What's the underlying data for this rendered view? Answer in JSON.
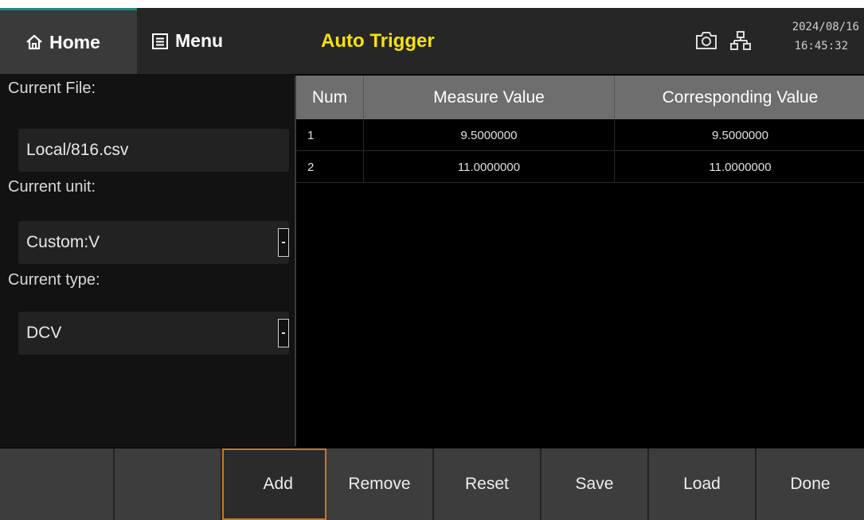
{
  "header": {
    "home_label": "Home",
    "menu_label": "Menu",
    "title": "Auto Trigger",
    "date": "2024/08/16",
    "time": "16:45:32"
  },
  "left": {
    "current_file_label": "Current File:",
    "current_file_value": "Local/816.csv",
    "current_unit_label": "Current unit:",
    "current_unit_value": "Custom:V",
    "current_type_label": "Current type:",
    "current_type_value": "DCV"
  },
  "table": {
    "columns": [
      "Num",
      "Measure Value",
      "Corresponding Value"
    ],
    "rows": [
      {
        "num": "1",
        "measure": "9.5000000",
        "corresponding": "9.5000000"
      },
      {
        "num": "2",
        "measure": "11.0000000",
        "corresponding": "11.0000000"
      }
    ]
  },
  "softkeys": {
    "k1": "",
    "k2": "",
    "k3": "Add",
    "k4": "Remove",
    "k5": "Reset",
    "k6": "Save",
    "k7": "Load",
    "k8": "Done"
  },
  "colors": {
    "title": "#f3e20f",
    "accent_teal": "#1e8c7e",
    "active_key_border": "#c57a2a"
  }
}
